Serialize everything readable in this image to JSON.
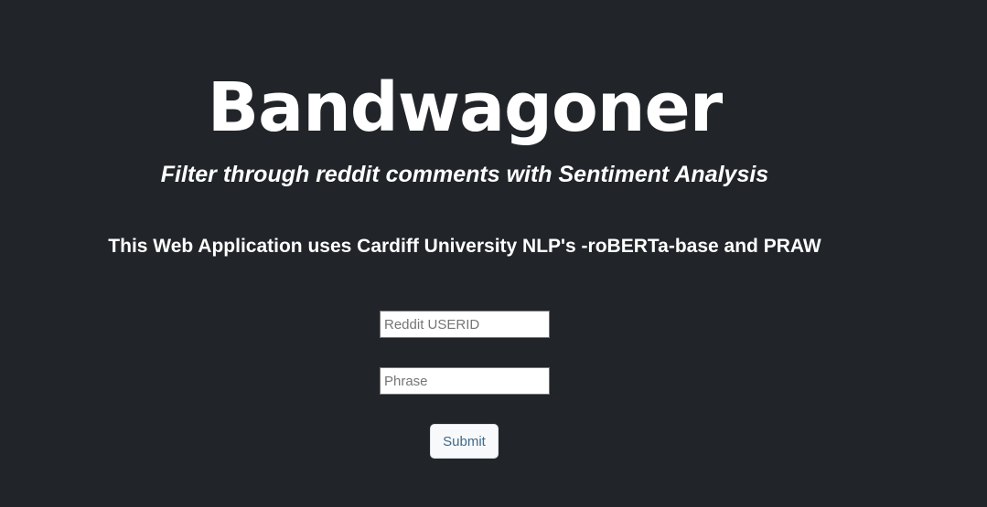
{
  "header": {
    "title": "Bandwagoner",
    "subtitle": "Filter through reddit comments with Sentiment Analysis",
    "info": "This Web Application uses Cardiff University NLP's -roBERTa-base and PRAW"
  },
  "form": {
    "userid_placeholder": "Reddit USERID",
    "userid_value": "",
    "phrase_placeholder": "Phrase",
    "phrase_value": "",
    "submit_label": "Submit"
  },
  "colors": {
    "background": "#212529",
    "text": "#ffffff",
    "button_bg": "#f8f9fa",
    "button_text": "#3d6a8c"
  }
}
